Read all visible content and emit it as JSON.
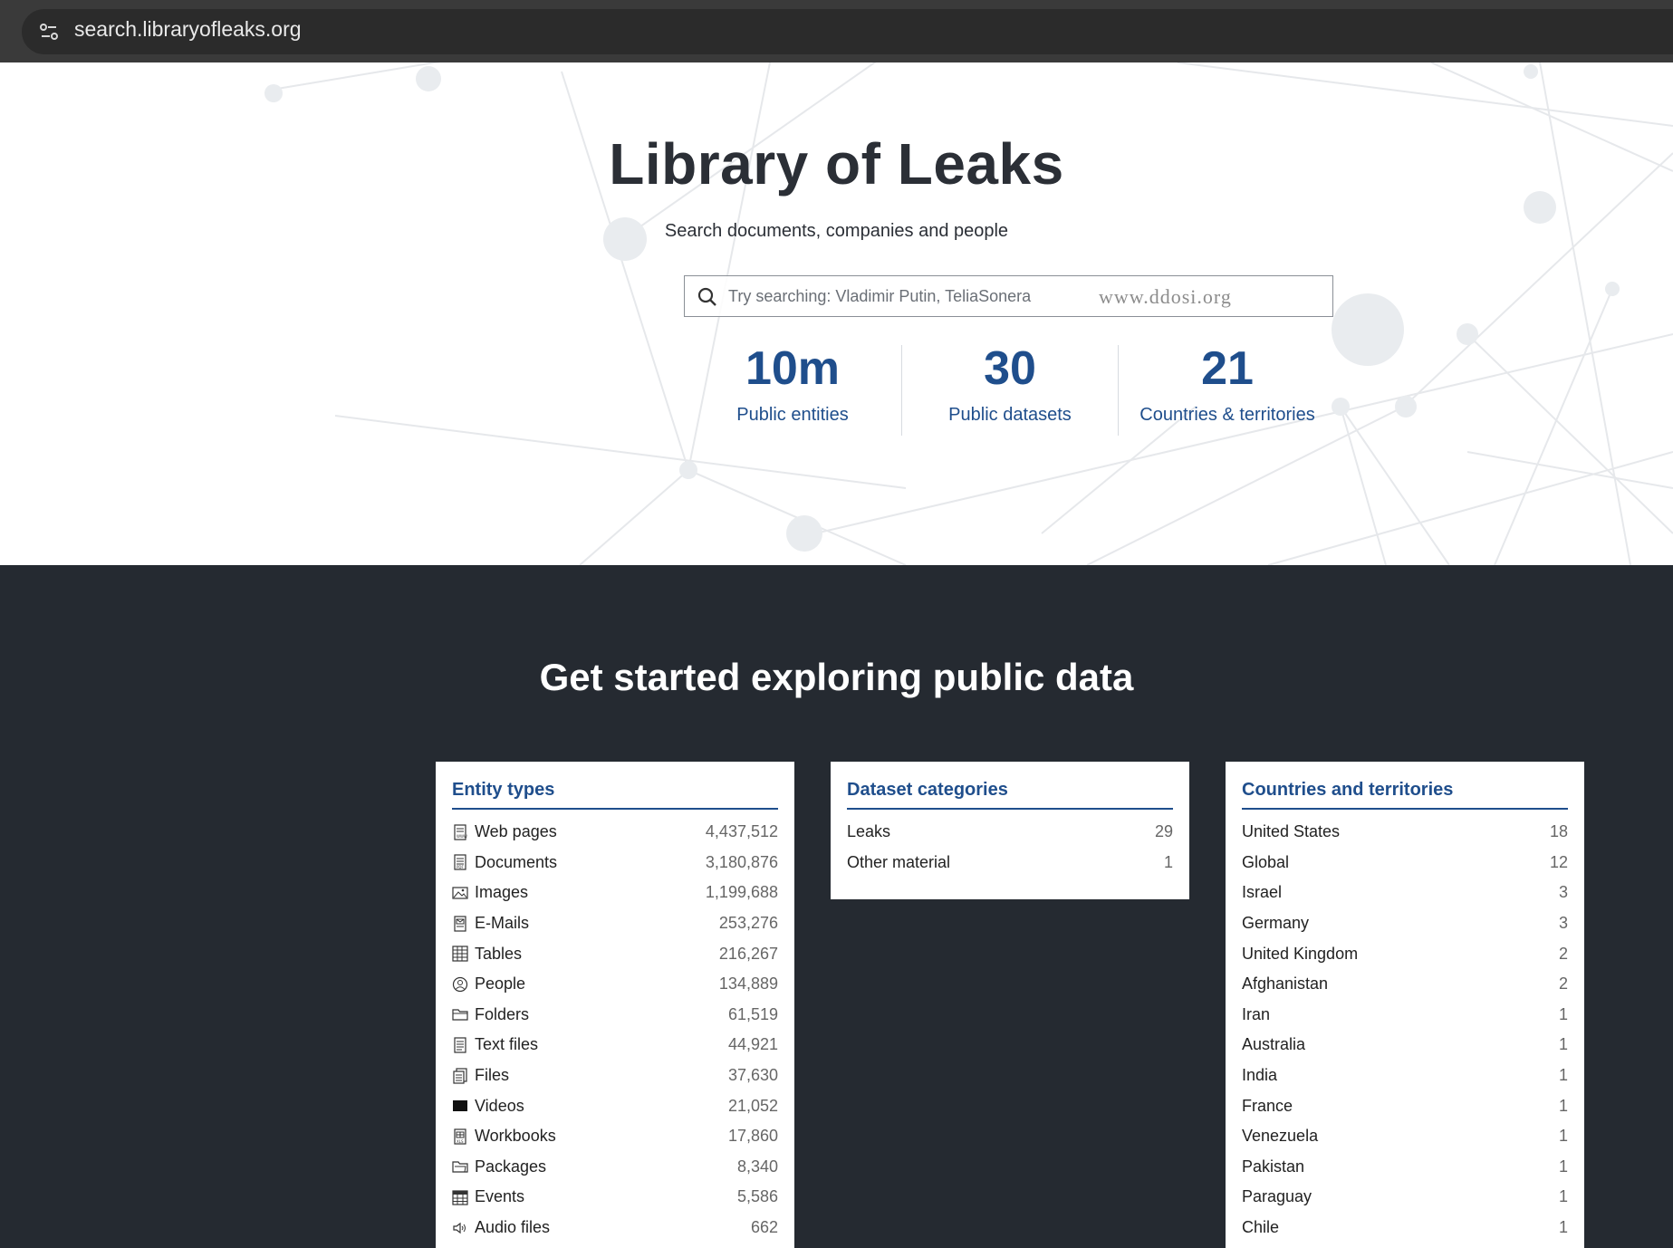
{
  "browser": {
    "url": "search.libraryofleaks.org"
  },
  "hero": {
    "title": "Library of Leaks",
    "subtitle": "Search documents, companies and people",
    "search_placeholder": "Try searching: Vladimir Putin, TeliaSonera",
    "watermark": "www.ddosi.org",
    "stats": [
      {
        "value": "10m",
        "label": "Public entities"
      },
      {
        "value": "30",
        "label": "Public datasets"
      },
      {
        "value": "21",
        "label": "Countries & territories"
      }
    ]
  },
  "explore": {
    "title": "Get started exploring public data",
    "entity_types": {
      "title": "Entity types",
      "items": [
        {
          "label": "Web pages",
          "count": "4,437,512",
          "icon": "web-page-icon"
        },
        {
          "label": "Documents",
          "count": "3,180,876",
          "icon": "document-icon"
        },
        {
          "label": "Images",
          "count": "1,199,688",
          "icon": "image-icon"
        },
        {
          "label": "E-Mails",
          "count": "253,276",
          "icon": "email-icon"
        },
        {
          "label": "Tables",
          "count": "216,267",
          "icon": "table-icon"
        },
        {
          "label": "People",
          "count": "134,889",
          "icon": "person-icon"
        },
        {
          "label": "Folders",
          "count": "61,519",
          "icon": "folder-icon"
        },
        {
          "label": "Text files",
          "count": "44,921",
          "icon": "text-file-icon"
        },
        {
          "label": "Files",
          "count": "37,630",
          "icon": "files-icon"
        },
        {
          "label": "Videos",
          "count": "21,052",
          "icon": "video-icon"
        },
        {
          "label": "Workbooks",
          "count": "17,860",
          "icon": "workbook-icon"
        },
        {
          "label": "Packages",
          "count": "8,340",
          "icon": "package-icon"
        },
        {
          "label": "Events",
          "count": "5,586",
          "icon": "calendar-icon"
        },
        {
          "label": "Audio files",
          "count": "662",
          "icon": "audio-icon"
        }
      ]
    },
    "dataset_categories": {
      "title": "Dataset categories",
      "items": [
        {
          "label": "Leaks",
          "count": "29"
        },
        {
          "label": "Other material",
          "count": "1"
        }
      ]
    },
    "countries": {
      "title": "Countries and territories",
      "items": [
        {
          "label": "United States",
          "count": "18"
        },
        {
          "label": "Global",
          "count": "12"
        },
        {
          "label": "Israel",
          "count": "3"
        },
        {
          "label": "Germany",
          "count": "3"
        },
        {
          "label": "United Kingdom",
          "count": "2"
        },
        {
          "label": "Afghanistan",
          "count": "2"
        },
        {
          "label": "Iran",
          "count": "1"
        },
        {
          "label": "Australia",
          "count": "1"
        },
        {
          "label": "India",
          "count": "1"
        },
        {
          "label": "France",
          "count": "1"
        },
        {
          "label": "Venezuela",
          "count": "1"
        },
        {
          "label": "Pakistan",
          "count": "1"
        },
        {
          "label": "Paraguay",
          "count": "1"
        },
        {
          "label": "Chile",
          "count": "1"
        }
      ]
    }
  },
  "colors": {
    "accent": "#1f4e8c",
    "dark_bg": "#252a31",
    "browser_bar": "#3a3a3a"
  }
}
